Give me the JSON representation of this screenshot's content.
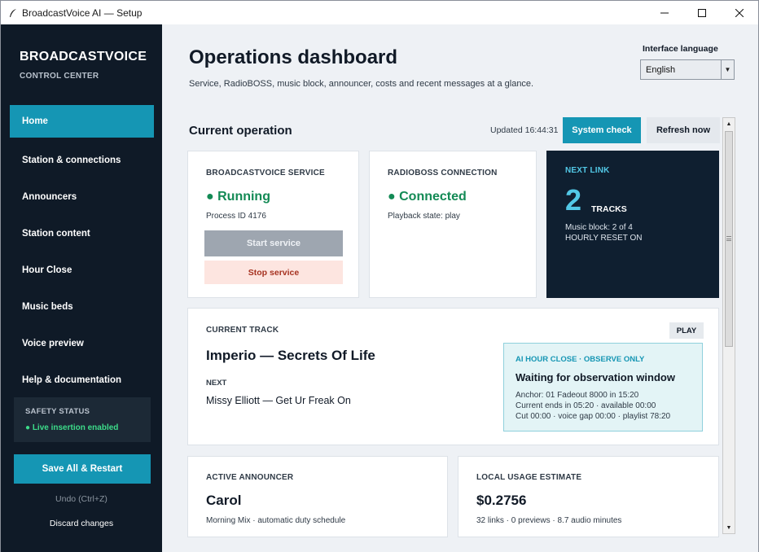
{
  "window": {
    "title": "BroadcastVoice AI — Setup"
  },
  "sidebar": {
    "brand": "BROADCASTVOICE",
    "brand_sub": "CONTROL CENTER",
    "items": [
      {
        "label": "Home",
        "active": true
      },
      {
        "label": "Station & connections"
      },
      {
        "label": "Announcers"
      },
      {
        "label": "Station content"
      },
      {
        "label": "Hour Close"
      },
      {
        "label": "Music beds"
      },
      {
        "label": "Voice preview"
      },
      {
        "label": "Help & documentation"
      }
    ],
    "safety_label": "SAFETY STATUS",
    "safety_value": "● Live insertion enabled",
    "save_label": "Save All & Restart",
    "undo_label": "Undo  (Ctrl+Z)",
    "discard_label": "Discard changes"
  },
  "header": {
    "title": "Operations dashboard",
    "subtitle": "Service, RadioBOSS, music block, announcer, costs and recent messages at a glance.",
    "language_label": "Interface language",
    "language_value": "English"
  },
  "operation": {
    "title": "Current operation",
    "updated": "Updated 16:44:31",
    "system_check_label": "System check",
    "refresh_label": "Refresh now"
  },
  "service": {
    "label": "BROADCASTVOICE SERVICE",
    "status": "● Running",
    "process": "Process ID 4176",
    "start_label": "Start service",
    "stop_label": "Stop service"
  },
  "radioboss": {
    "label": "RADIOBOSS CONNECTION",
    "status": "● Connected",
    "playback": "Playback state: play"
  },
  "next_link": {
    "label": "NEXT LINK",
    "count": "2",
    "unit": "TRACKS",
    "music_block": "Music block: 2 of 4",
    "reset": "HOURLY RESET ON"
  },
  "current_track": {
    "label": "CURRENT TRACK",
    "play_label": "PLAY",
    "title": "Imperio — Secrets Of Life",
    "next_label": "NEXT",
    "next_value": "Missy Elliott — Get Ur Freak On"
  },
  "ai_hour_close": {
    "label": "AI HOUR CLOSE · OBSERVE ONLY",
    "heading": "Waiting for observation window",
    "lines": [
      "Anchor: 01 Fadeout 8000 in 15:20",
      "Current ends in 05:20 · available 00:00",
      "Cut 00:00 · voice gap 00:00 · playlist 78:20"
    ]
  },
  "announcer": {
    "label": "ACTIVE ANNOUNCER",
    "name": "Carol",
    "detail": "Morning Mix · automatic duty schedule"
  },
  "usage": {
    "label": "LOCAL USAGE ESTIMATE",
    "cost": "$0.2756",
    "detail": "32 links · 0 previews · 8.7 audio minutes"
  },
  "colors": {
    "accent": "#1596b4",
    "sidebar_bg": "#0f1a27",
    "ok_green": "#138a55",
    "stop_red": "#a63220"
  }
}
